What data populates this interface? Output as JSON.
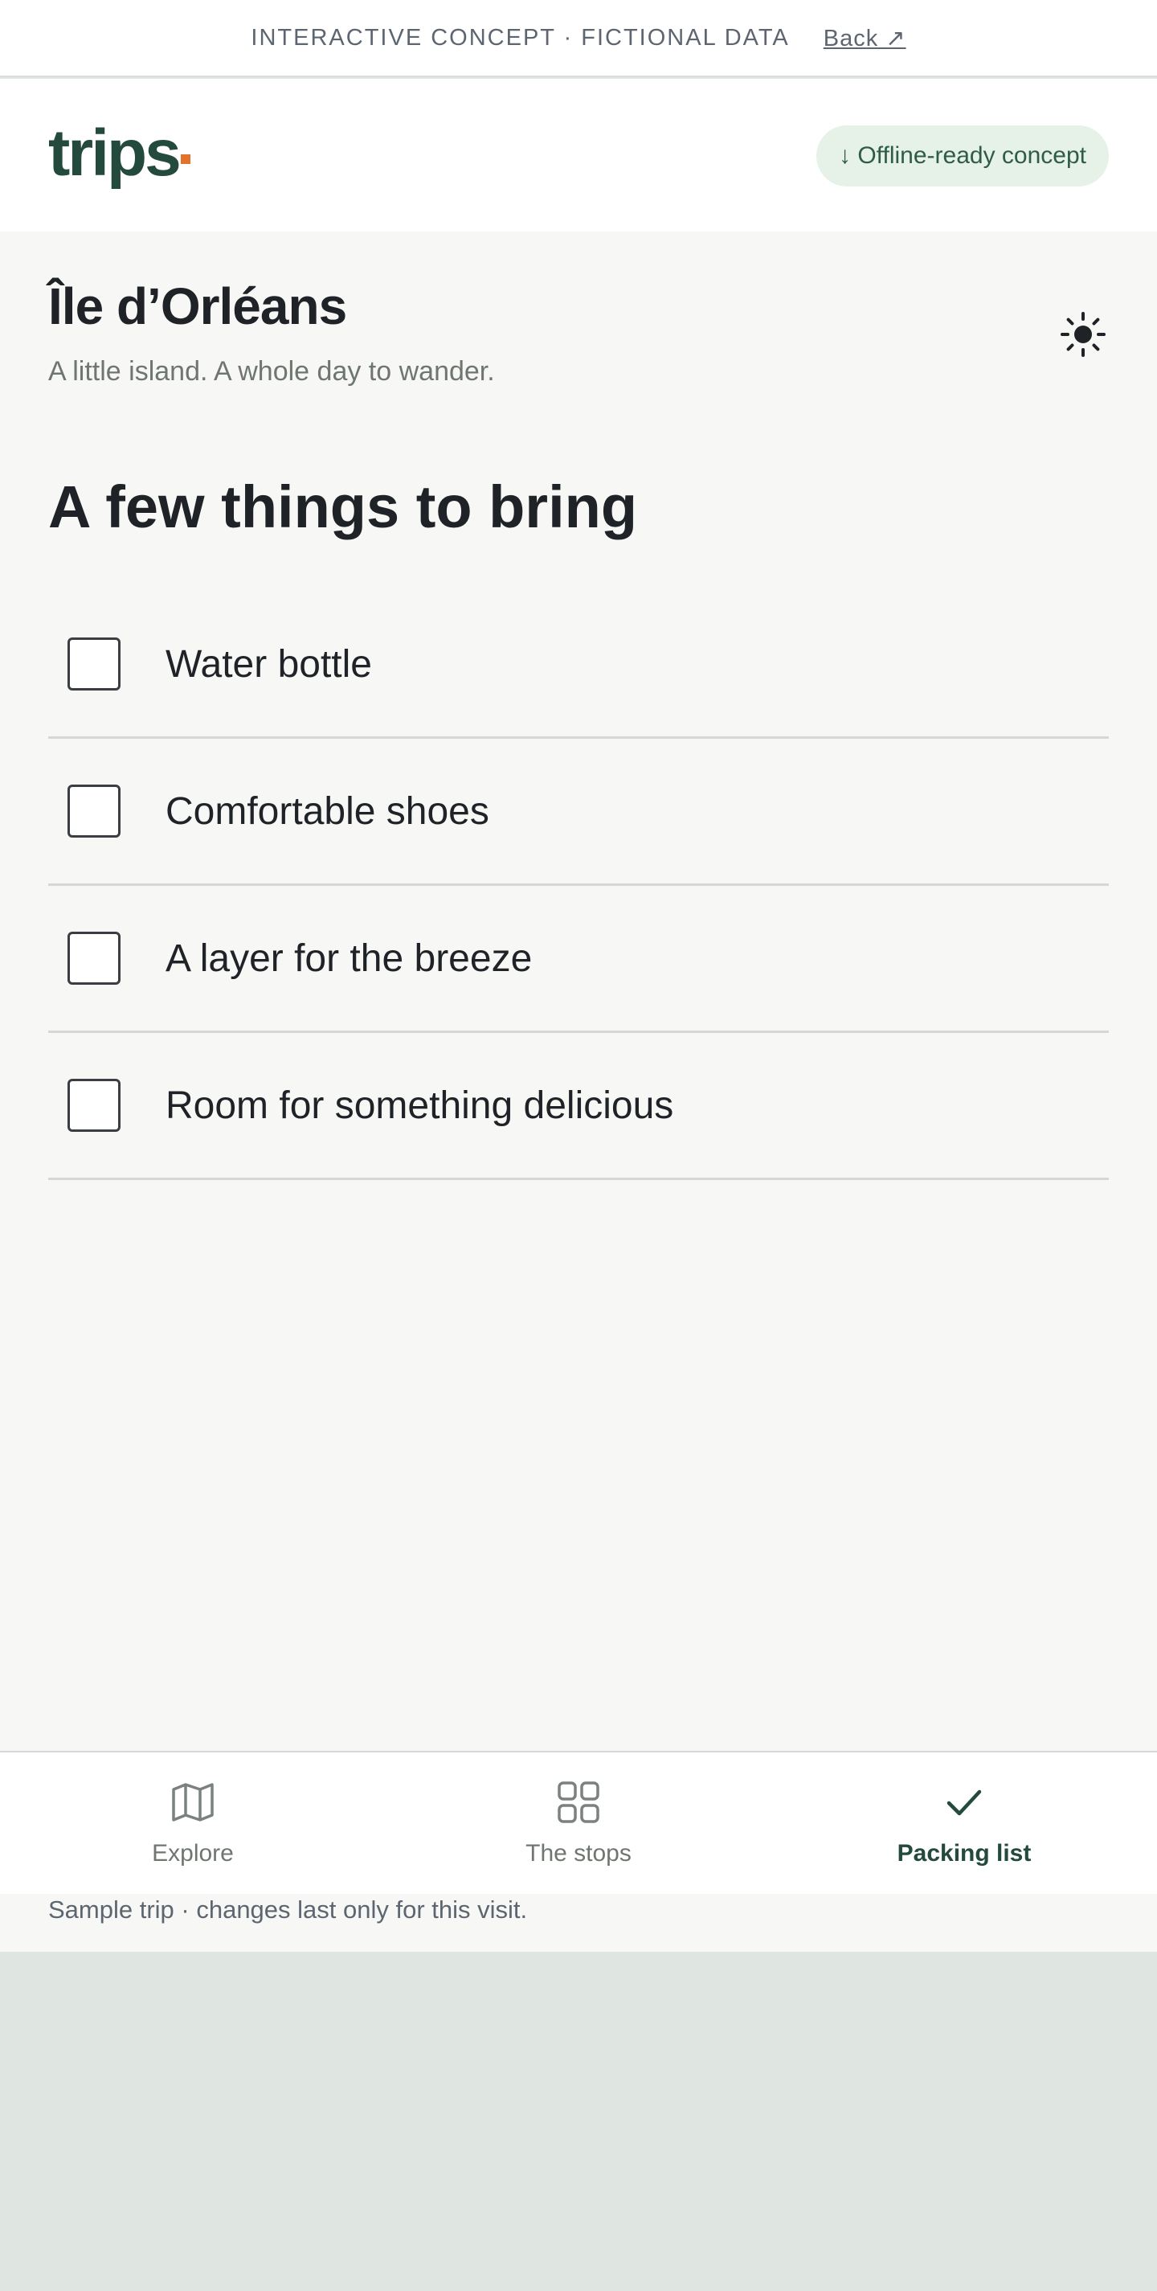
{
  "topbar": {
    "note": "INTERACTIVE CONCEPT · FICTIONAL DATA",
    "back_label": "Back ↗"
  },
  "header": {
    "logo": "trips",
    "offline_badge": "↓ Offline-ready concept",
    "accent_color": "#234a3c",
    "dot_color": "#e3722b"
  },
  "place": {
    "title": "Île d’Orléans",
    "subtitle": "A little island. A whole day to wander.",
    "theme_icon": "sun-icon"
  },
  "packing": {
    "title": "A few things to bring",
    "items": [
      {
        "label": "Water bottle",
        "checked": false
      },
      {
        "label": "Comfortable shoes",
        "checked": false
      },
      {
        "label": "A layer for the breeze",
        "checked": false
      },
      {
        "label": "Room for something delicious",
        "checked": false
      }
    ]
  },
  "tabs": [
    {
      "label": "Explore",
      "icon": "map-icon",
      "active": false
    },
    {
      "label": "The stops",
      "icon": "grid-icon",
      "active": false
    },
    {
      "label": "Packing list",
      "icon": "check-icon",
      "active": true
    }
  ],
  "footer": {
    "note": "Sample trip · changes last only for this visit."
  }
}
